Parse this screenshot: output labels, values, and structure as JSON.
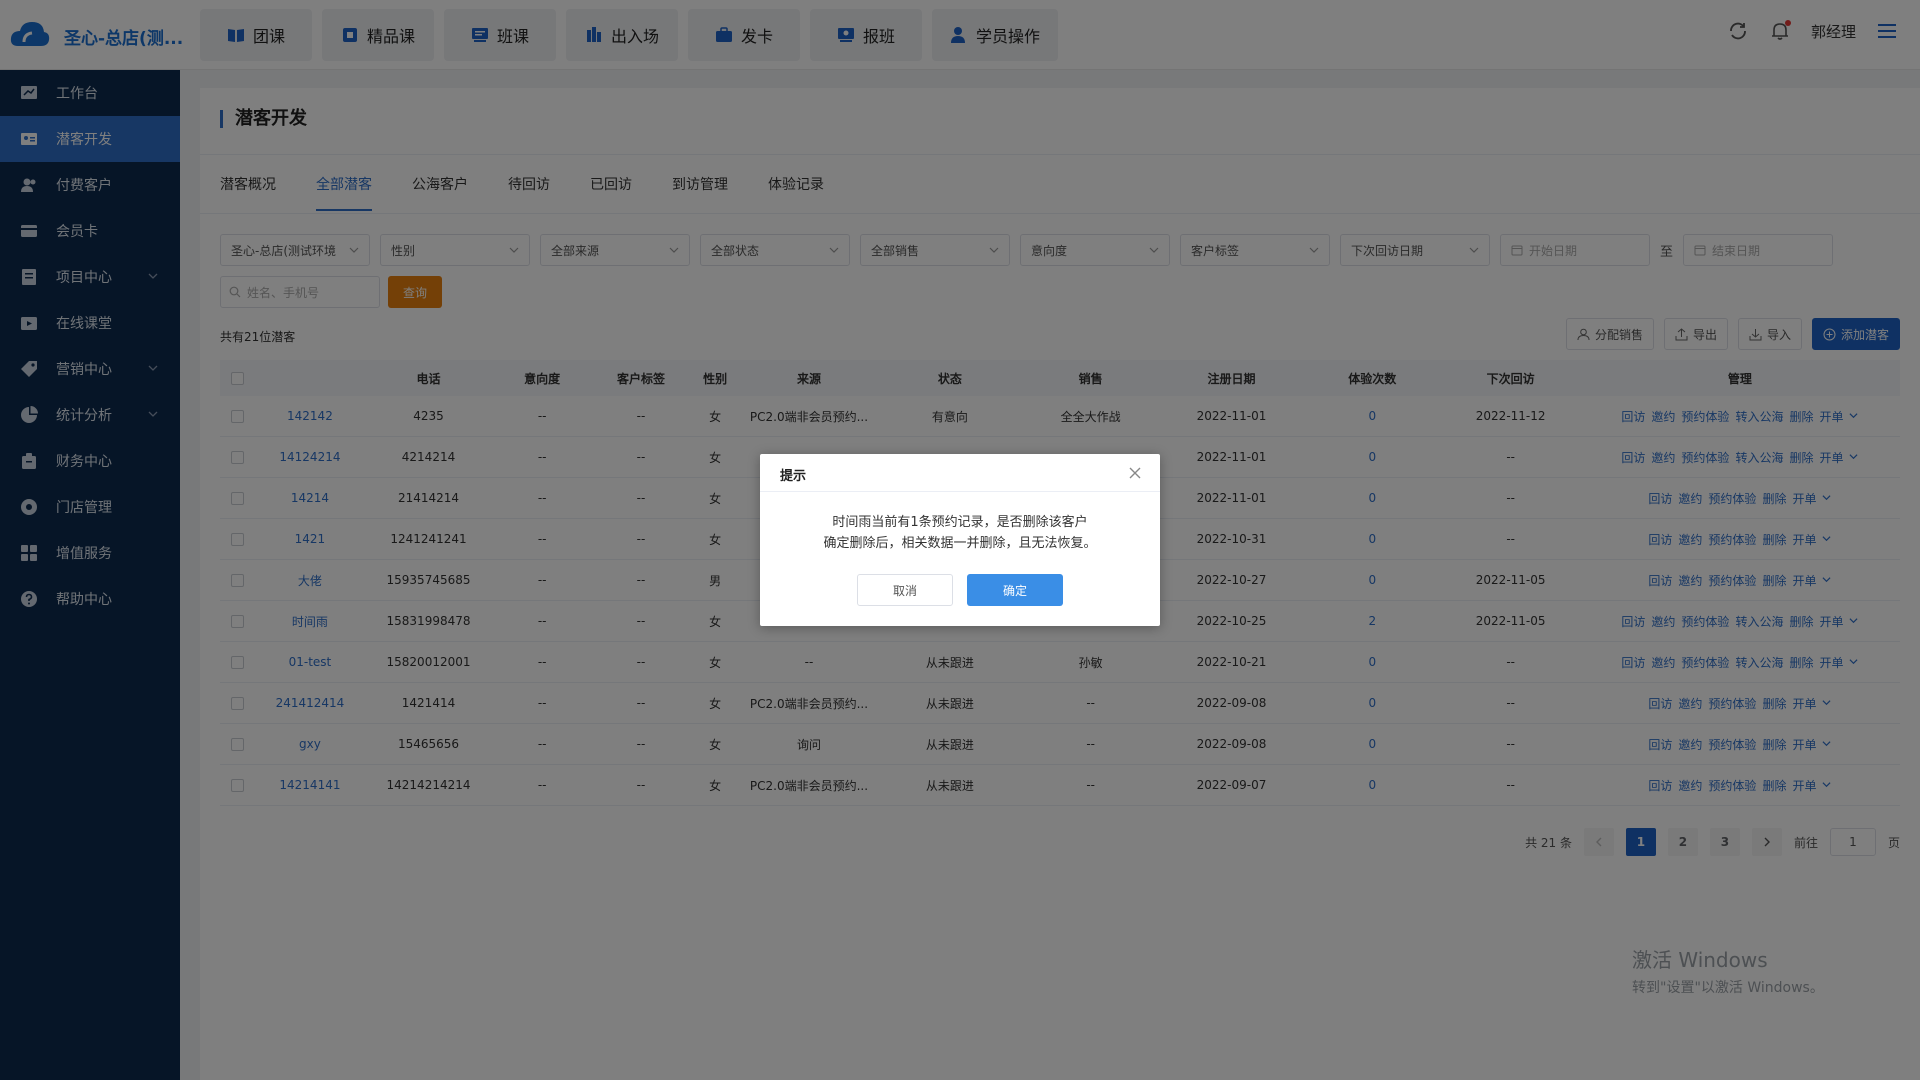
{
  "header": {
    "brand": "圣心-总店(测...",
    "nav": [
      {
        "label": "团课",
        "icon": "book-icon"
      },
      {
        "label": "精品课",
        "icon": "premium-course-icon"
      },
      {
        "label": "班课",
        "icon": "class-icon"
      },
      {
        "label": "出入场",
        "icon": "entry-exit-icon"
      },
      {
        "label": "发卡",
        "icon": "card-issue-icon"
      },
      {
        "label": "报班",
        "icon": "enroll-icon"
      },
      {
        "label": "学员操作",
        "icon": "student-icon"
      }
    ],
    "username": "郭经理"
  },
  "sidebar": {
    "items": [
      {
        "label": "工作台",
        "icon": "dashboard-icon"
      },
      {
        "label": "潜客开发",
        "icon": "prospect-icon",
        "active": true
      },
      {
        "label": "付费客户",
        "icon": "customers-icon"
      },
      {
        "label": "会员卡",
        "icon": "card-icon"
      },
      {
        "label": "项目中心",
        "icon": "project-icon"
      },
      {
        "label": "在线课堂",
        "icon": "online-class-icon"
      },
      {
        "label": "营销中心",
        "icon": "marketing-icon"
      },
      {
        "label": "统计分析",
        "icon": "analytics-icon"
      },
      {
        "label": "财务中心",
        "icon": "finance-icon"
      },
      {
        "label": "门店管理",
        "icon": "store-icon"
      },
      {
        "label": "增值服务",
        "icon": "services-icon"
      },
      {
        "label": "帮助中心",
        "icon": "help-icon"
      }
    ]
  },
  "page": {
    "title": "潜客开发",
    "tabs": [
      "潜客概况",
      "全部潜客",
      "公海客户",
      "待回访",
      "已回访",
      "到访管理",
      "体验记录"
    ],
    "active_tab": 1
  },
  "filters": {
    "selects": [
      "圣心-总店(测试环境",
      "性别",
      "全部来源",
      "全部状态",
      "全部销售",
      "意向度",
      "客户标签",
      "下次回访日期"
    ],
    "start_date": "开始日期",
    "range_sep": "至",
    "end_date": "结束日期",
    "search_placeholder": "姓名、手机号",
    "query_label": "查询"
  },
  "count_text": "共有21位潜客",
  "actions": {
    "assign": "分配销售",
    "export": "导出",
    "import": "导入",
    "add": "添加潜客"
  },
  "table": {
    "headers": [
      "",
      "电话",
      "意向度",
      "客户标签",
      "性别",
      "来源",
      "状态",
      "销售",
      "注册日期",
      "体验次数",
      "下次回访",
      "管理"
    ],
    "rows": [
      {
        "name": "142142",
        "phone": "4235",
        "intent": "--",
        "tag": "--",
        "gender": "女",
        "source": "PC2.0端非会员预约...",
        "status": "有意向",
        "sales": "全全大作战",
        "reg": "2022-11-01",
        "trial": "0",
        "next": "2022-11-12",
        "actions": [
          "回访",
          "邀约",
          "预约体验",
          "转入公海",
          "删除",
          "开单"
        ]
      },
      {
        "name": "14124214",
        "phone": "4214214",
        "intent": "--",
        "tag": "--",
        "gender": "女",
        "source": "",
        "status": "",
        "sales": "",
        "reg": "2022-11-01",
        "trial": "0",
        "next": "--",
        "actions": [
          "回访",
          "邀约",
          "预约体验",
          "转入公海",
          "删除",
          "开单"
        ]
      },
      {
        "name": "14214",
        "phone": "21414214",
        "intent": "--",
        "tag": "--",
        "gender": "女",
        "source": "",
        "status": "",
        "sales": "",
        "reg": "2022-11-01",
        "trial": "0",
        "next": "--",
        "actions": [
          "回访",
          "邀约",
          "预约体验",
          "删除",
          "开单"
        ]
      },
      {
        "name": "1421",
        "phone": "1241241241",
        "intent": "--",
        "tag": "--",
        "gender": "女",
        "source": "",
        "status": "",
        "sales": "",
        "reg": "2022-10-31",
        "trial": "0",
        "next": "--",
        "actions": [
          "回访",
          "邀约",
          "预约体验",
          "删除",
          "开单"
        ]
      },
      {
        "name": "大佬",
        "phone": "15935745685",
        "intent": "--",
        "tag": "--",
        "gender": "男",
        "source": "",
        "status": "",
        "sales": "",
        "reg": "2022-10-27",
        "trial": "0",
        "next": "2022-11-05",
        "actions": [
          "回访",
          "邀约",
          "预约体验",
          "删除",
          "开单"
        ]
      },
      {
        "name": "时间雨",
        "phone": "15831998478",
        "intent": "--",
        "tag": "--",
        "gender": "女",
        "source": "",
        "status": "",
        "sales": "",
        "reg": "2022-10-25",
        "trial": "2",
        "next": "2022-11-05",
        "actions": [
          "回访",
          "邀约",
          "预约体验",
          "转入公海",
          "删除",
          "开单"
        ]
      },
      {
        "name": "01-test",
        "phone": "15820012001",
        "intent": "--",
        "tag": "--",
        "gender": "女",
        "source": "--",
        "status": "从未跟进",
        "sales": "孙敏",
        "reg": "2022-10-21",
        "trial": "0",
        "next": "--",
        "actions": [
          "回访",
          "邀约",
          "预约体验",
          "转入公海",
          "删除",
          "开单"
        ]
      },
      {
        "name": "241412414",
        "phone": "1421414",
        "intent": "--",
        "tag": "--",
        "gender": "女",
        "source": "PC2.0端非会员预约...",
        "status": "从未跟进",
        "sales": "--",
        "reg": "2022-09-08",
        "trial": "0",
        "next": "--",
        "actions": [
          "回访",
          "邀约",
          "预约体验",
          "删除",
          "开单"
        ]
      },
      {
        "name": "gxy",
        "phone": "15465656",
        "intent": "--",
        "tag": "--",
        "gender": "女",
        "source": "询问",
        "status": "从未跟进",
        "sales": "--",
        "reg": "2022-09-08",
        "trial": "0",
        "next": "--",
        "actions": [
          "回访",
          "邀约",
          "预约体验",
          "删除",
          "开单"
        ]
      },
      {
        "name": "14214141",
        "phone": "14214214214",
        "intent": "--",
        "tag": "--",
        "gender": "女",
        "source": "PC2.0端非会员预约...",
        "status": "从未跟进",
        "sales": "--",
        "reg": "2022-09-07",
        "trial": "0",
        "next": "--",
        "actions": [
          "回访",
          "邀约",
          "预约体验",
          "删除",
          "开单"
        ]
      }
    ]
  },
  "pagination": {
    "total": "共 21 条",
    "pages": [
      "1",
      "2",
      "3"
    ],
    "current": "1",
    "goto_label": "前往",
    "goto_value": "1",
    "page_suffix": "页"
  },
  "watermark": {
    "line1": "激活 Windows",
    "line2": "转到\"设置\"以激活 Windows。"
  },
  "dialog": {
    "title": "提示",
    "message_line1": "时间雨当前有1条预约记录，是否删除该客户",
    "message_line2": "确定删除后，相关数据一并删除，且无法恢复。",
    "cancel": "取消",
    "confirm": "确定"
  },
  "colors": {
    "sidebar_bg": "#0d2a4f",
    "accent": "#2f6fc9",
    "query_btn": "#e8800e",
    "confirm_btn": "#3a8ee6"
  }
}
